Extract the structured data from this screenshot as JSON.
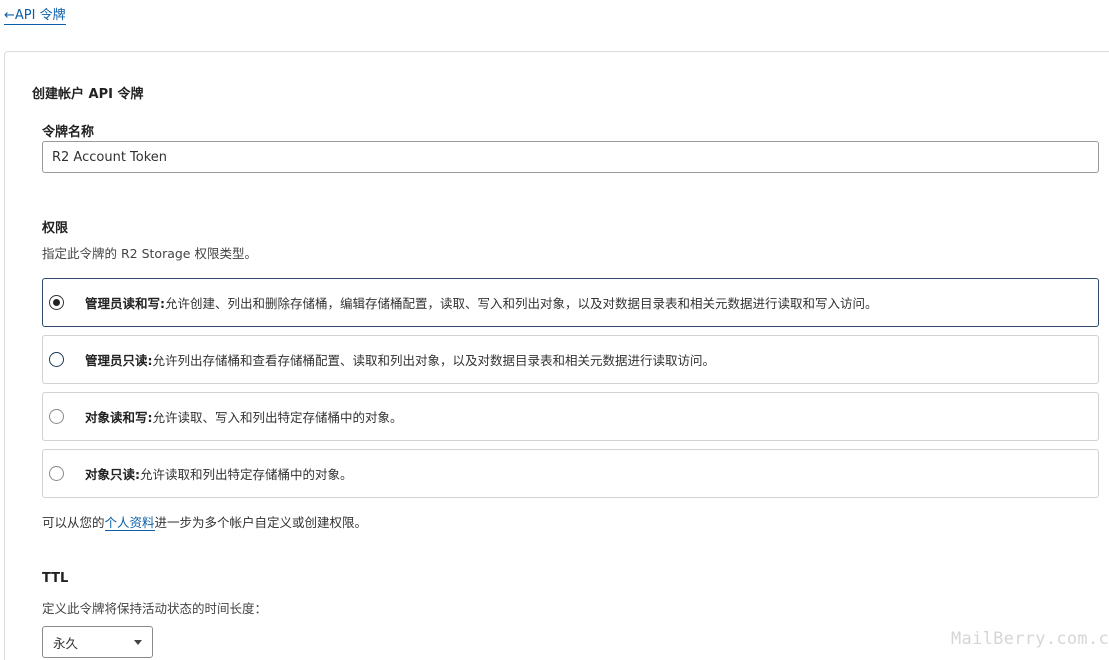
{
  "back_link": {
    "arrow": "←",
    "label": "API 令牌"
  },
  "form": {
    "title": "创建帐户 API 令牌",
    "token_name": {
      "label": "令牌名称",
      "value": "R2 Account Token"
    },
    "permissions": {
      "label": "权限",
      "description": "指定此令牌的 R2 Storage 权限类型。",
      "options": [
        {
          "title": "管理员读和写:",
          "description": "允许创建、列出和删除存储桶，编辑存储桶配置，读取、写入和列出对象，以及对数据目录表和相关元数据进行读取和写入访问。",
          "selected": true
        },
        {
          "title": "管理员只读:",
          "description": "允许列出存储桶和查看存储桶配置、读取和列出对象，以及对数据目录表和相关元数据进行读取访问。",
          "selected": false
        },
        {
          "title": "对象读和写:",
          "description": "允许读取、写入和列出特定存储桶中的对象。",
          "selected": false
        },
        {
          "title": "对象只读:",
          "description": "允许读取和列出特定存储桶中的对象。",
          "selected": false
        }
      ],
      "profile_note_before": "可以从您的",
      "profile_link": "个人资料",
      "profile_note_after": "进一步为多个帐户自定义或创建权限。"
    },
    "ttl": {
      "label": "TTL",
      "description": "定义此令牌将保持活动状态的时间长度：",
      "selected": "永久"
    }
  },
  "watermark": "MailBerry.com.cn"
}
